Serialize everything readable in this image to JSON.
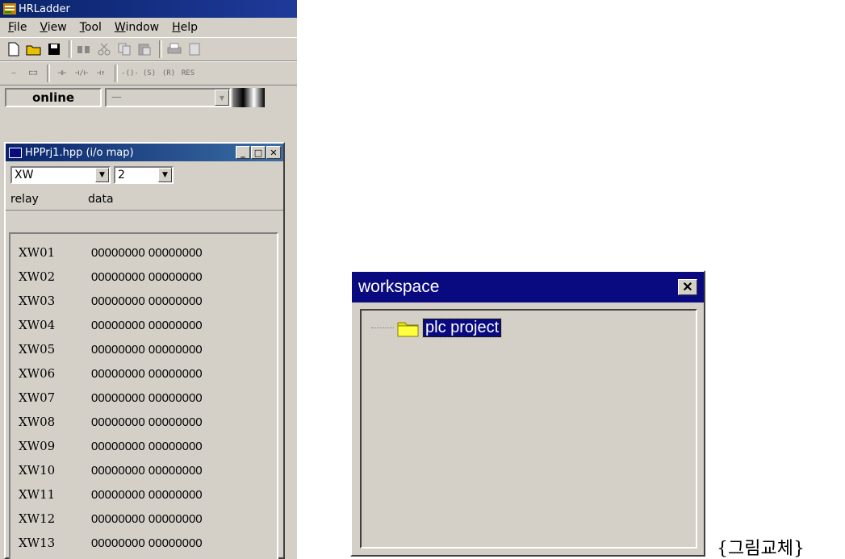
{
  "app": {
    "title": "HRLadder",
    "menu": [
      {
        "underline": "F",
        "rest": "ile"
      },
      {
        "underline": "V",
        "rest": "iew"
      },
      {
        "underline": "T",
        "rest": "ool"
      },
      {
        "underline": "W",
        "rest": "indow"
      },
      {
        "underline": "H",
        "rest": "elp"
      }
    ],
    "status": "online",
    "status_combo": "—"
  },
  "io_window": {
    "title": "HPPrj1.hpp (i/o map)",
    "device_select": "XW",
    "index_select": "2",
    "headers": {
      "relay": "relay",
      "data": "data"
    },
    "rows": [
      {
        "relay": "XW01",
        "data": "00000000 00000000"
      },
      {
        "relay": "XW02",
        "data": "00000000 00000000"
      },
      {
        "relay": "XW03",
        "data": "00000000 00000000"
      },
      {
        "relay": "XW04",
        "data": "00000000 00000000"
      },
      {
        "relay": "XW05",
        "data": "00000000 00000000"
      },
      {
        "relay": "XW06",
        "data": "00000000 00000000"
      },
      {
        "relay": "XW07",
        "data": "00000000 00000000"
      },
      {
        "relay": "XW08",
        "data": "00000000 00000000"
      },
      {
        "relay": "XW09",
        "data": "00000000 00000000"
      },
      {
        "relay": "XW10",
        "data": "00000000 00000000"
      },
      {
        "relay": "XW11",
        "data": "00000000 00000000"
      },
      {
        "relay": "XW12",
        "data": "00000000 00000000"
      },
      {
        "relay": "XW13",
        "data": "00000000 00000000"
      }
    ]
  },
  "workspace": {
    "title": "workspace",
    "tree": [
      {
        "label": "plc project"
      }
    ]
  },
  "caption": "{그림교체}",
  "colors": {
    "titlebar": "#0a246a",
    "face": "#d4d0c8",
    "selection": "#0a0a80"
  },
  "icons": [
    "new-icon",
    "open-folder-icon",
    "save-icon",
    "find-icon",
    "cut-icon",
    "copy-icon",
    "paste-icon",
    "print-icon",
    "preview-icon"
  ]
}
